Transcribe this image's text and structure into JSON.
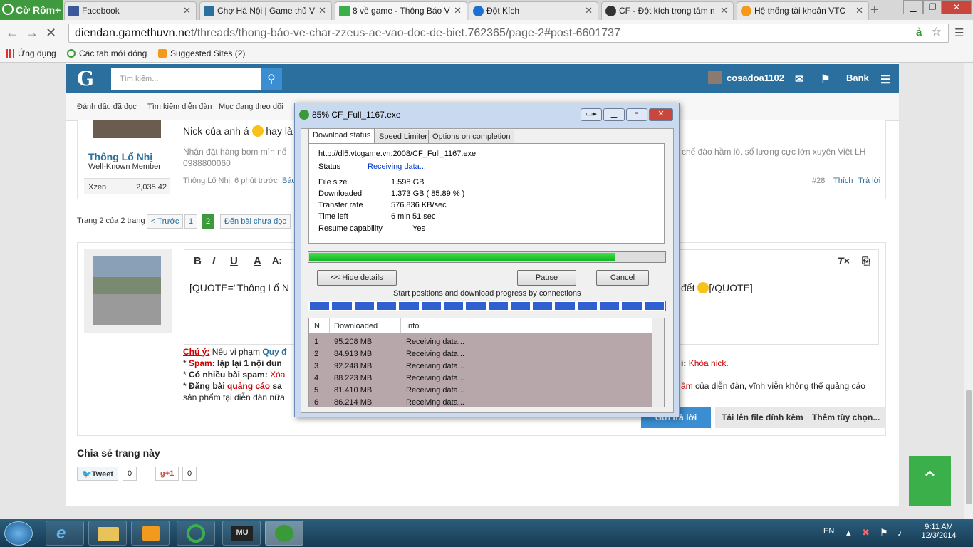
{
  "browser": {
    "coc_label": "Cờ Rôm+",
    "tabs": [
      {
        "label": "Facebook"
      },
      {
        "label": "Chợ Hà Nội | Game thủ V"
      },
      {
        "label": "8 về game - Thông Báo V"
      },
      {
        "label": "Đột Kích"
      },
      {
        "label": "CF - Đột kích trong tâm n"
      },
      {
        "label": "Hệ thống tài khoản VTC"
      }
    ],
    "url_host": "diendan.gamethuvn.net",
    "url_path": "/threads/thong-báo-ve-char-zzeus-ae-vao-doc-de-biet.762365/page-2#post-6601737",
    "bookmarks": {
      "apps": "Ứng dụng",
      "closed": "Các tab mới đóng",
      "suggested": "Suggested Sites (2)"
    }
  },
  "forum": {
    "logo": "G",
    "search_placeholder": "Tìm kiếm...",
    "username": "cosadoa1102",
    "bank": "Bank",
    "subnav": [
      "Đánh dấu đã đọc",
      "Tìm kiếm diễn đàn",
      "Mục đang theo dõi"
    ],
    "post": {
      "author": "Thông Lổ Nhị",
      "title": "Well-Known Member",
      "stat_label": "Xzen",
      "stat_value": "2,035.42",
      "text_start": "Nick của anh á",
      "text_end": "hay là",
      "sig_line1": "Nhận đặt hàng bom mìn nổ",
      "sig_line1_end": "chế đào hầm lò. số lượng cực lớn xuyên Việt LH",
      "sig_line2": "0988800060",
      "meta": "Thông Lổ Nhị, 6 phút trước",
      "meta_report": "Báo",
      "post_no": "#28",
      "like": "Thích",
      "reply": "Trả lời"
    },
    "pager": {
      "label": "Trang 2 của 2 trang",
      "prev": "< Trước",
      "p1": "1",
      "p2": "2",
      "unread": "Đến bài chưa đọc"
    },
    "editor": {
      "quote_start": "[QUOTE=\"Thông Lổ N",
      "quote_end": "đết",
      "quote_close": "[/QUOTE]"
    },
    "rules": {
      "note": "Chú ý:",
      "note_text": "Nếu vi phạm",
      "note_link": "Quy đ",
      "spam": "Spam:",
      "spam_text": "lặp lại 1 nội dun",
      "many": "Có nhiều bài spam:",
      "many_red": "Xóa",
      "ads1": "Đăng bài",
      "ads_red": "quảng cáo",
      "ads2": "sa",
      "line4": "sản phẩm tại diễn đàn nữa",
      "right1_label": "i:",
      "right1_red": "Khóa nick.",
      "right2_red": "âm",
      "right2": "của diễn đàn, vĩnh viễn không thể quảng cáo"
    },
    "buttons": {
      "send": "Gửi trả lời",
      "upload": "Tải lên file đính kèm",
      "more": "Thêm tùy chọn..."
    },
    "share": {
      "title": "Chia sẻ trang này",
      "tweet": "Tweet",
      "tweet_count": "0",
      "gplus": "g+1",
      "gplus_count": "0"
    }
  },
  "idm": {
    "title": "85% CF_Full_1167.exe",
    "tabs": [
      "Download status",
      "Speed Limiter",
      "Options on completion"
    ],
    "url": "http://dl5.vtcgame.vn:2008/CF_Full_1167.exe",
    "status_label": "Status",
    "status_value": "Receiving data...",
    "rows": [
      {
        "label": "File size",
        "value": "1.598  GB"
      },
      {
        "label": "Downloaded",
        "value": "1.373  GB  ( 85.89 % )"
      },
      {
        "label": "Transfer rate",
        "value": "576.836  KB/sec"
      },
      {
        "label": "Time left",
        "value": "6 min 51 sec"
      },
      {
        "label": "Resume capability",
        "value": "Yes"
      }
    ],
    "progress": 0.8589,
    "buttons": {
      "hide": "<< Hide details",
      "pause": "Pause",
      "cancel": "Cancel"
    },
    "conn_caption": "Start positions and download progress by connections",
    "connections": 16,
    "columns": [
      "N.",
      "Downloaded",
      "Info"
    ],
    "list": [
      {
        "n": "1",
        "dl": "95.208  MB",
        "info": "Receiving data..."
      },
      {
        "n": "2",
        "dl": "84.913  MB",
        "info": "Receiving data..."
      },
      {
        "n": "3",
        "dl": "92.248  MB",
        "info": "Receiving data..."
      },
      {
        "n": "4",
        "dl": "88.223  MB",
        "info": "Receiving data..."
      },
      {
        "n": "5",
        "dl": "81.410  MB",
        "info": "Receiving data..."
      },
      {
        "n": "6",
        "dl": "86.214  MB",
        "info": "Receiving data..."
      }
    ]
  },
  "taskbar": {
    "lang": "EN",
    "time": "9:11 AM",
    "date": "12/3/2014"
  },
  "colors": {
    "accent": "#2a6f9e",
    "green": "#3aaf4a",
    "progress": "#22c22e"
  }
}
